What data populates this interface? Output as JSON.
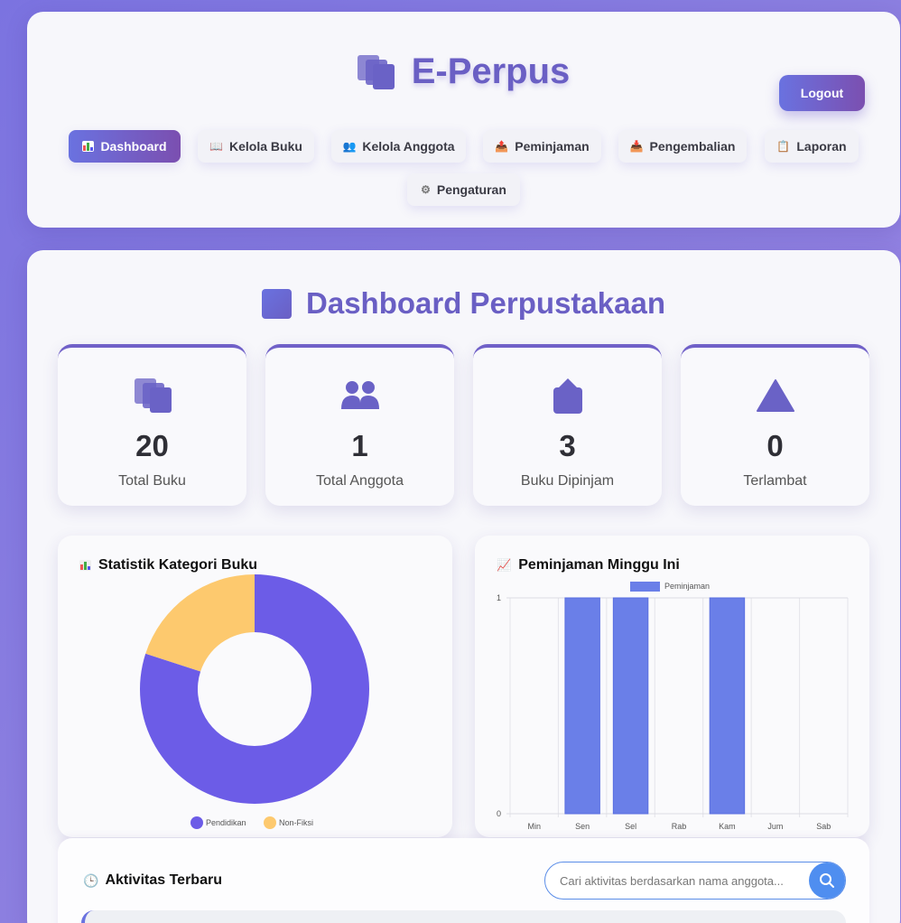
{
  "app": {
    "title": "E-Perpus"
  },
  "header": {
    "logout_label": "Logout",
    "nav": [
      {
        "label": "Dashboard",
        "icon": "bar-chart-icon",
        "active": true
      },
      {
        "label": "Kelola Buku",
        "icon": "open-book-icon"
      },
      {
        "label": "Kelola Anggota",
        "icon": "people-icon"
      },
      {
        "label": "Peminjaman",
        "icon": "outbox-icon"
      },
      {
        "label": "Pengembalian",
        "icon": "inbox-icon"
      },
      {
        "label": "Laporan",
        "icon": "clipboard-icon"
      },
      {
        "label": "Pengaturan",
        "icon": "gear-icon"
      }
    ]
  },
  "dashboard": {
    "title": "Dashboard Perpustakaan",
    "stats": [
      {
        "value": "20",
        "label": "Total Buku",
        "icon": "books-icon"
      },
      {
        "value": "1",
        "label": "Total Anggota",
        "icon": "people-icon"
      },
      {
        "value": "3",
        "label": "Buku Dipinjam",
        "icon": "outbox-icon"
      },
      {
        "value": "0",
        "label": "Terlambat",
        "icon": "warning-icon"
      }
    ]
  },
  "charts": {
    "category_title": "Statistik Kategori Buku",
    "weekly_title": "Peminjaman Minggu Ini"
  },
  "activity": {
    "title": "Aktivitas Terbaru",
    "search_placeholder": "Cari aktivitas berdasarkan nama anggota..."
  },
  "colors": {
    "accent": "#6a5fc4",
    "purple_slice": "#6c5ce7",
    "yellow_slice": "#fdc96e",
    "bar": "#6a7fe8"
  },
  "chart_data": [
    {
      "type": "pie",
      "title": "Statistik Kategori Buku",
      "categories": [
        "Pendidikan",
        "Non-Fiksi"
      ],
      "values": [
        80,
        20
      ],
      "colors": [
        "#6c5ce7",
        "#fdc96e"
      ],
      "legend": "bottom"
    },
    {
      "type": "bar",
      "title": "Peminjaman Minggu Ini",
      "categories": [
        "Min",
        "Sen",
        "Sel",
        "Rab",
        "Kam",
        "Jum",
        "Sab"
      ],
      "series": [
        {
          "name": "Peminjaman",
          "values": [
            0,
            1,
            1,
            0,
            1,
            0,
            0
          ]
        }
      ],
      "ylim": [
        0,
        1
      ],
      "yticks": [
        "0",
        "1"
      ],
      "grid": true,
      "legend": "top"
    }
  ]
}
